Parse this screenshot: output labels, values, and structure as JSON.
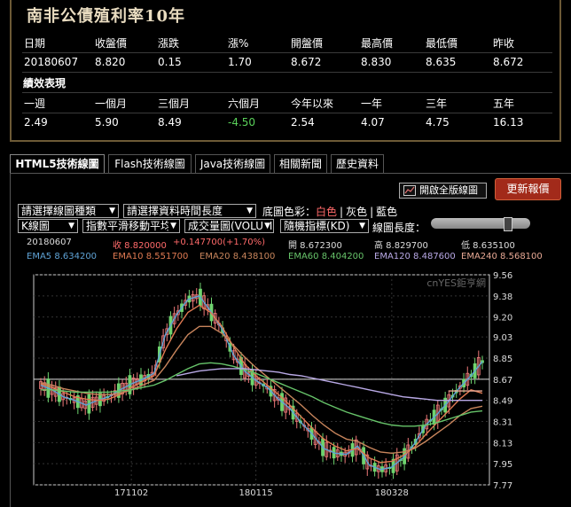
{
  "header": {
    "title": "南非公債殖利率10年"
  },
  "quote": {
    "labels": [
      "日期",
      "收盤價",
      "漲跌",
      "漲%",
      "開盤價",
      "最高價",
      "最低價",
      "昨收"
    ],
    "values": [
      "20180607",
      "8.820",
      "0.15",
      "1.70",
      "8.672",
      "8.830",
      "8.635",
      "8.672"
    ]
  },
  "performance": {
    "title": "績效表現",
    "labels": [
      "一週",
      "一個月",
      "三個月",
      "六個月",
      "今年以來",
      "一年",
      "三年",
      "五年"
    ],
    "values": [
      "2.49",
      "5.90",
      "8.49",
      "-4.50",
      "2.54",
      "4.07",
      "4.75",
      "16.13"
    ]
  },
  "tabs": [
    "HTML5技術線圖",
    "Flash技術線圖",
    "Java技術線圖",
    "相關新聞",
    "歷史資料"
  ],
  "toolbar": {
    "fullscreen_label": "開啟全版線圖",
    "refresh_label": "更新報價",
    "chart_type_select": "請選擇線圖種類",
    "period_select": "請選擇資料時間長度",
    "bg_label": "底圖色彩：",
    "bg_white": "白色",
    "bg_gray": "灰色",
    "bg_blue": "藍色",
    "sep": "|",
    "kline_select": "K線圖",
    "indicator_select": "指數平滑移動平均",
    "volume_select": "成交量圖(VOLUME)",
    "random_select": "隨機指標(KD)",
    "length_label": "線圖長度："
  },
  "info": {
    "date": "20180607",
    "close": "收 8.820000",
    "change": "+0.147700(+1.70%)",
    "open": "開 8.672300",
    "high": "高 8.829700",
    "low": "低 8.635100",
    "ema5": "EMA5 8.634200",
    "ema10": "EMA10 8.551700",
    "ema20": "EMA20 8.438100",
    "ema60": "EMA60 8.404200",
    "ema120": "EMA120 8.487600",
    "ema240": "EMA240 8.568100"
  },
  "colors": {
    "ema5": "#5fa3d6",
    "ema10": "#e07a52",
    "ema20": "#c8855c",
    "ema60": "#67c46a",
    "ema120": "#b9a9e6",
    "ema240": "#e7a894",
    "up": "#f07a7a",
    "down": "#6fd46f",
    "green": "#5ad05a",
    "panel_border": "#6d5a36",
    "refresh_bg": "#a22a1a"
  },
  "chart_data": {
    "type": "line",
    "watermark": "cnYES鉅亨網",
    "ylim": [
      7.77,
      9.56
    ],
    "yticks": [
      "9.56",
      "9.38",
      "9.20",
      "9.03",
      "8.85",
      "8.67",
      "8.49",
      "8.31",
      "8.13",
      "7.95",
      "7.77"
    ],
    "xticks": [
      "171102",
      "180115",
      "180328"
    ],
    "series": [
      {
        "name": "EMA5",
        "values": [
          8.62,
          8.58,
          8.52,
          8.49,
          8.45,
          8.49,
          8.52,
          8.58,
          8.63,
          8.67,
          8.72,
          9.05,
          9.22,
          9.35,
          9.38,
          9.25,
          9.1,
          8.88,
          8.74,
          8.66,
          8.6,
          8.5,
          8.42,
          8.3,
          8.2,
          8.08,
          8.04,
          8.03,
          8.1,
          7.94,
          7.9,
          7.92,
          8.0,
          8.12,
          8.28,
          8.37,
          8.48,
          8.6,
          8.7,
          8.82
        ]
      },
      {
        "name": "EMA10",
        "values": [
          8.63,
          8.6,
          8.56,
          8.52,
          8.5,
          8.49,
          8.5,
          8.54,
          8.6,
          8.65,
          8.7,
          8.92,
          9.1,
          9.24,
          9.3,
          9.24,
          9.12,
          8.95,
          8.8,
          8.7,
          8.62,
          8.54,
          8.45,
          8.35,
          8.25,
          8.16,
          8.1,
          8.06,
          8.08,
          8.0,
          7.96,
          7.97,
          8.02,
          8.09,
          8.2,
          8.3,
          8.4,
          8.5,
          8.58,
          8.55
        ]
      },
      {
        "name": "EMA20",
        "values": [
          8.64,
          8.62,
          8.59,
          8.57,
          8.55,
          8.54,
          8.54,
          8.55,
          8.58,
          8.62,
          8.66,
          8.78,
          8.92,
          9.05,
          9.12,
          9.12,
          9.06,
          8.96,
          8.86,
          8.77,
          8.69,
          8.61,
          8.53,
          8.45,
          8.36,
          8.28,
          8.21,
          8.16,
          8.14,
          8.09,
          8.05,
          8.04,
          8.05,
          8.08,
          8.14,
          8.21,
          8.28,
          8.36,
          8.42,
          8.44
        ]
      },
      {
        "name": "EMA60",
        "values": [
          8.58,
          8.58,
          8.57,
          8.56,
          8.56,
          8.56,
          8.56,
          8.57,
          8.58,
          8.6,
          8.62,
          8.66,
          8.71,
          8.76,
          8.8,
          8.81,
          8.8,
          8.78,
          8.75,
          8.72,
          8.68,
          8.64,
          8.6,
          8.56,
          8.52,
          8.47,
          8.43,
          8.39,
          8.36,
          8.33,
          8.3,
          8.28,
          8.27,
          8.27,
          8.28,
          8.3,
          8.33,
          8.36,
          8.39,
          8.4
        ]
      },
      {
        "name": "EMA120",
        "values": [
          null,
          null,
          null,
          null,
          null,
          null,
          null,
          null,
          null,
          null,
          null,
          null,
          8.7,
          8.72,
          8.74,
          8.75,
          8.76,
          8.76,
          8.76,
          8.75,
          8.74,
          8.73,
          8.71,
          8.7,
          8.68,
          8.66,
          8.64,
          8.62,
          8.6,
          8.58,
          8.56,
          8.54,
          8.52,
          8.51,
          8.5,
          8.49,
          8.49,
          8.49,
          8.49,
          8.49
        ]
      },
      {
        "name": "EMA240",
        "values": [
          null,
          null,
          null,
          null,
          null,
          null,
          null,
          null,
          null,
          null,
          null,
          null,
          null,
          null,
          null,
          null,
          null,
          null,
          null,
          null,
          null,
          null,
          null,
          null,
          null,
          null,
          null,
          null,
          null,
          null,
          null,
          null,
          null,
          null,
          null,
          null,
          8.57,
          8.57,
          8.57,
          8.57
        ]
      }
    ],
    "reference_line": 8.67
  }
}
